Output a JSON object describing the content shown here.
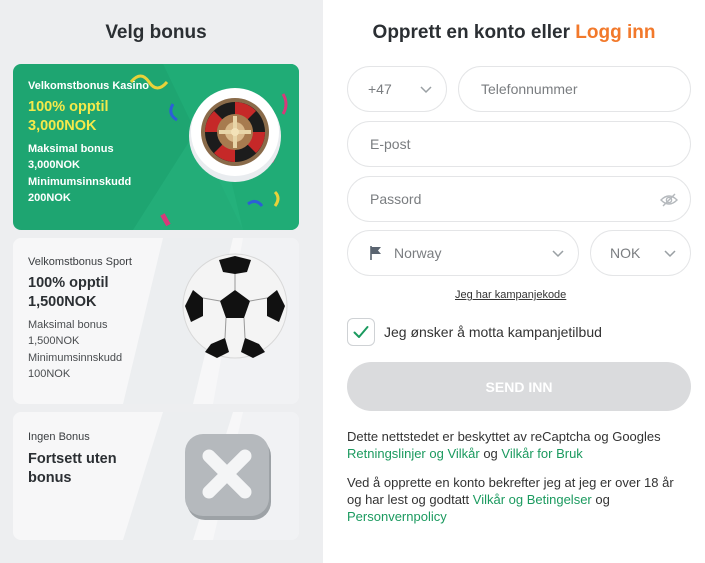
{
  "left": {
    "title": "Velg bonus",
    "cards": [
      {
        "name": "Velkomstbonus Kasino",
        "headline_1": "100% opptil",
        "headline_2": "3,000NOK",
        "line_1": "Maksimal bonus",
        "line_2": "3,000NOK",
        "line_3": "Minimumsinnskudd",
        "line_4": "200NOK",
        "icon": "roulette-wheel-icon"
      },
      {
        "name": "Velkomstbonus Sport",
        "headline_1": "100% opptil",
        "headline_2": "1,500NOK",
        "line_1": "Maksimal bonus",
        "line_2": "1,500NOK",
        "line_3": "Minimumsinnskudd",
        "line_4": "100NOK",
        "icon": "soccer-ball-icon"
      },
      {
        "name": "Ingen Bonus",
        "headline_1": "Fortsett uten",
        "headline_2": "bonus",
        "icon": "close-x-icon"
      }
    ]
  },
  "right": {
    "title_prefix": "Opprett en konto eller ",
    "title_link": "Logg inn",
    "phone_code": "+47",
    "phone_placeholder": "Telefonnummer",
    "email_placeholder": "E-post",
    "password_placeholder": "Passord",
    "country": "Norway",
    "currency": "NOK",
    "promo_link": "Jeg har kampanjekode",
    "checkbox_label": "Jeg ønsker å motta kampanjetilbud",
    "checkbox_checked": true,
    "submit_label": "SEND INN",
    "legal_1_a": "Dette nettstedet er beskyttet av reCaptcha og Googles ",
    "legal_1_link_1": "Retningslinjer og Vilkår",
    "legal_1_b": " og ",
    "legal_1_link_2": "Vilkår for Bruk",
    "legal_2_a": "Ved å opprette en konto bekrefter jeg at jeg er over 18 år og har lest og godtatt ",
    "legal_2_link_1": "Vilkår og Betingelser",
    "legal_2_b": " og ",
    "legal_2_link_2": "Personvernpolicy"
  },
  "colors": {
    "accent_orange": "#f2792b",
    "casino_green": "#1ea571",
    "link_green": "#1b9a5f",
    "headline_yellow": "#f5e94a"
  }
}
